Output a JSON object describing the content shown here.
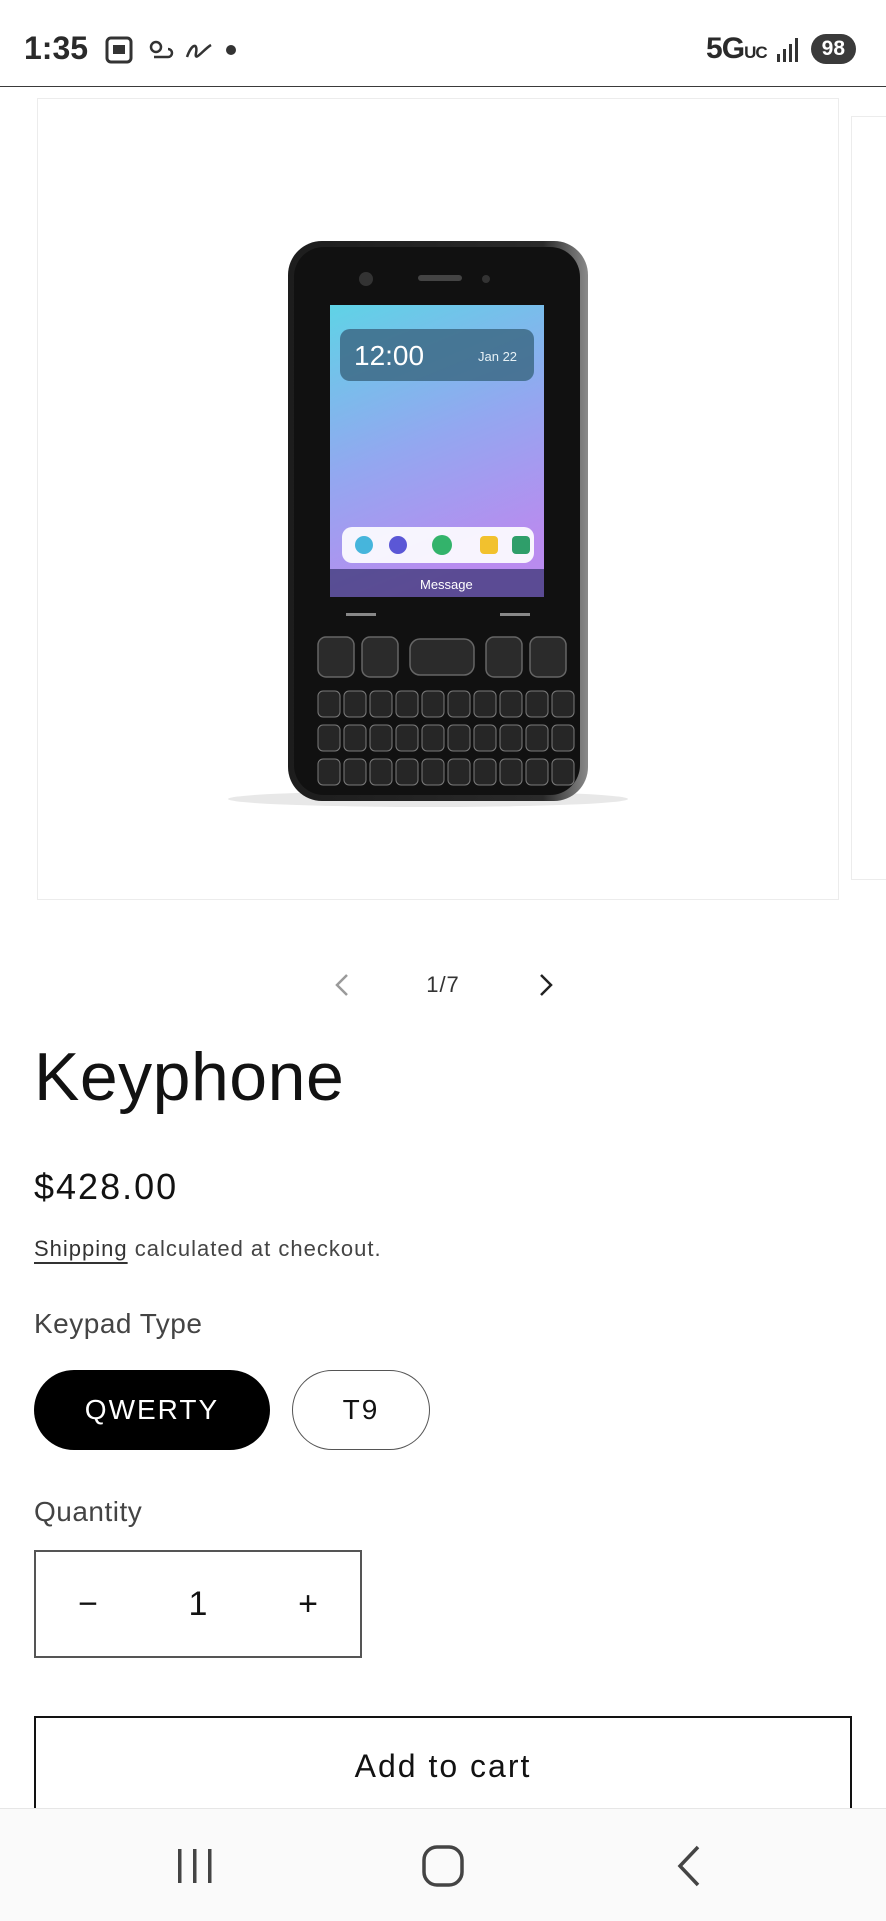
{
  "status_bar": {
    "time": "1:35",
    "network": "5G",
    "network_suffix": "UC",
    "battery": "98",
    "icons": [
      "screenshot-icon",
      "weather-icon",
      "signature-icon",
      "dot-icon",
      "signal-icon"
    ]
  },
  "gallery": {
    "counter": "1/7",
    "image_alt": "Keyphone",
    "current_index": 1,
    "total": 7
  },
  "product": {
    "title": "Keyphone",
    "price": "$428.00",
    "shipping_link": "Shipping",
    "shipping_rest": " calculated at checkout."
  },
  "variants": {
    "label": "Keypad Type",
    "options": [
      {
        "label": "QWERTY",
        "selected": true
      },
      {
        "label": "T9",
        "selected": false
      }
    ]
  },
  "quantity": {
    "label": "Quantity",
    "value": "1",
    "minus": "−",
    "plus": "+"
  },
  "cart": {
    "add_label": "Add to cart"
  },
  "colors": {
    "selected_pill_bg": "#000000",
    "text": "#121212"
  },
  "navigation": {
    "icons": [
      "recent-apps-icon",
      "home-icon",
      "back-icon"
    ]
  }
}
